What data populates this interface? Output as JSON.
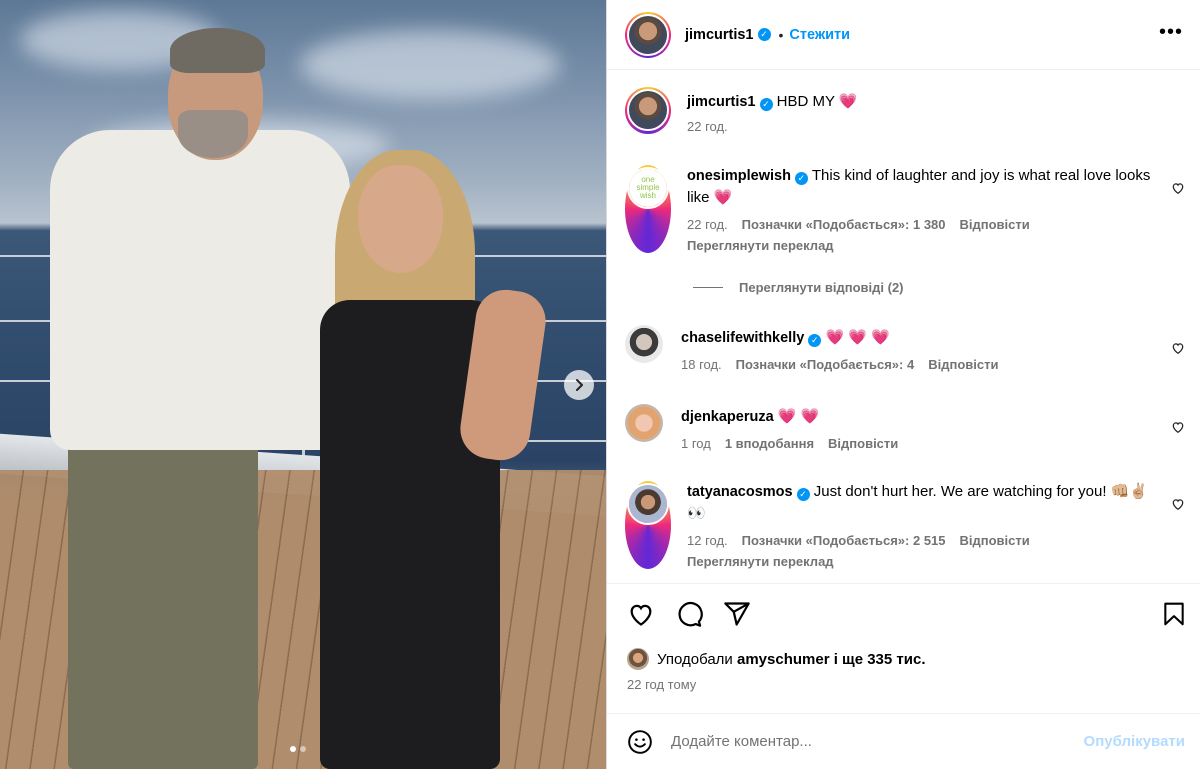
{
  "post": {
    "author": "jimcurtis1",
    "follow_label": "Стежити",
    "more_label": "•••",
    "carousel": {
      "current_slide": 1,
      "total_slides": 2
    }
  },
  "caption": {
    "user": "jimcurtis1",
    "text": "HBD MY",
    "emoji": "💗",
    "time": "22 год."
  },
  "comments": [
    {
      "user": "onesimplewish",
      "verified": true,
      "text": "This kind of laughter and joy is what real love looks like",
      "emoji": "💗",
      "time": "22 год.",
      "likes": "Позначки «Подобається»: 1 380",
      "reply": "Відповісти",
      "translate": "Переглянути переклад",
      "view_replies": "Переглянути відповіді (2)",
      "avatar_text": "one simple wish"
    },
    {
      "user": "chaselifewithkelly",
      "verified": true,
      "text": "",
      "emoji": "💗 💗 💗",
      "time": "18 год.",
      "likes": "Позначки «Подобається»: 4",
      "reply": "Відповісти"
    },
    {
      "user": "djenkaperuza",
      "verified": false,
      "text": "",
      "emoji": "💗 💗",
      "time": "1 год",
      "likes": "1 вподобання",
      "reply": "Відповісти"
    },
    {
      "user": "tatyanacosmos",
      "verified": true,
      "text": "Just don't hurt her. We are watching for you!",
      "emoji": "👊🏼✌🏼👀",
      "time": "12 год.",
      "likes": "Позначки «Подобається»: 2 515",
      "reply": "Відповісти",
      "translate": "Переглянути переклад"
    }
  ],
  "likes_summary": {
    "prefix": "Уподобали",
    "user": "amyschumer",
    "suffix": "і ще 335 тис."
  },
  "posted_ago": "22 год тому",
  "composer": {
    "placeholder": "Додайте коментар...",
    "publish_label": "Опублікувати"
  },
  "icons": {
    "like": "heart-icon",
    "comment": "comment-icon",
    "share": "share-icon",
    "save": "bookmark-icon",
    "emoji": "emoji-icon",
    "next": "chevron-right-icon",
    "verified": "verified-icon"
  },
  "colors": {
    "accent": "#0095f6",
    "heart": "#ed2f5a",
    "muted": "#737373",
    "publish_disabled": "#b3dbff"
  }
}
